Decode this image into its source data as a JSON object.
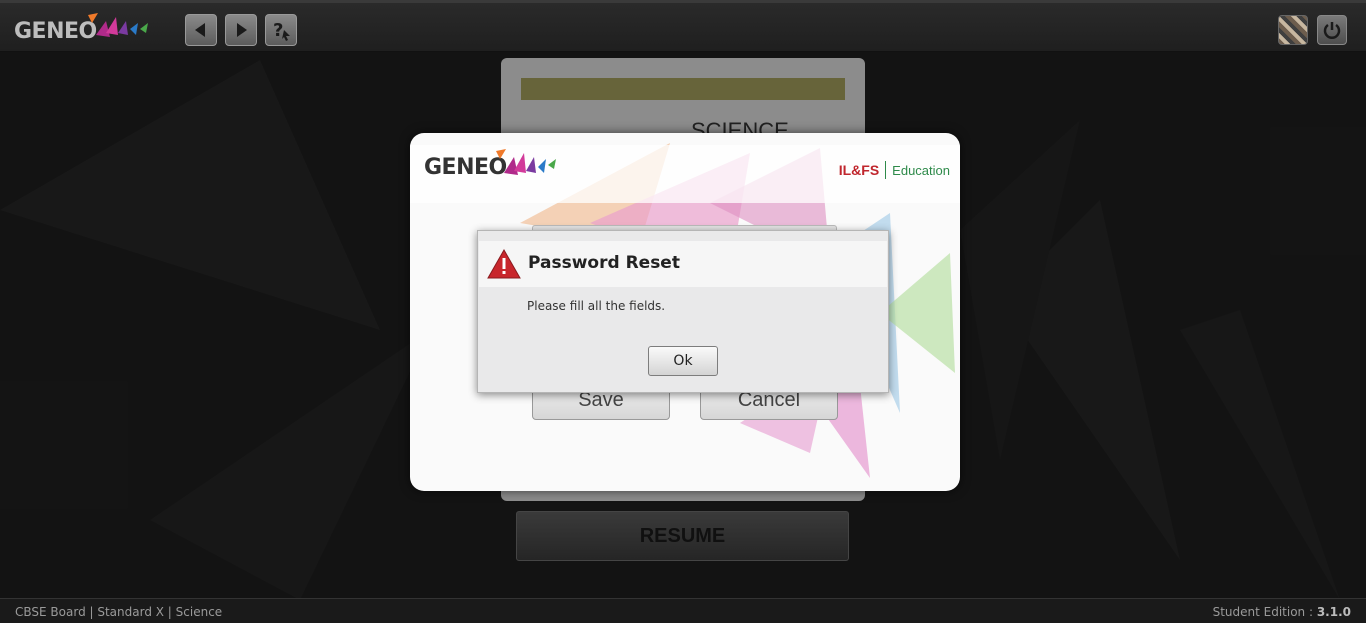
{
  "app": {
    "logo_text": "GENEO"
  },
  "toolbar": {
    "back_icon": "back-arrow-icon",
    "forward_icon": "forward-arrow-icon",
    "help_icon": "help-icon",
    "avatar_icon": "user-avatar",
    "power_icon": "power-icon"
  },
  "background_card": {
    "subject": "SCIENCE",
    "resume_label": "RESUME"
  },
  "modal": {
    "logo_text": "GENEO",
    "partner_brand": "IL&FS",
    "partner_division": "Education",
    "save_label": "Save",
    "cancel_label": "Cancel"
  },
  "alert": {
    "title": "Password Reset",
    "message": "Please fill all the fields.",
    "ok_label": "Ok",
    "icon": "warning-icon"
  },
  "footer": {
    "breadcrumb": "CBSE Board | Standard X | Science",
    "edition_label": "Student Edition : ",
    "version": "3.1.0"
  },
  "colors": {
    "accent_red": "#c0262d",
    "partner_green": "#2e8a4a"
  }
}
